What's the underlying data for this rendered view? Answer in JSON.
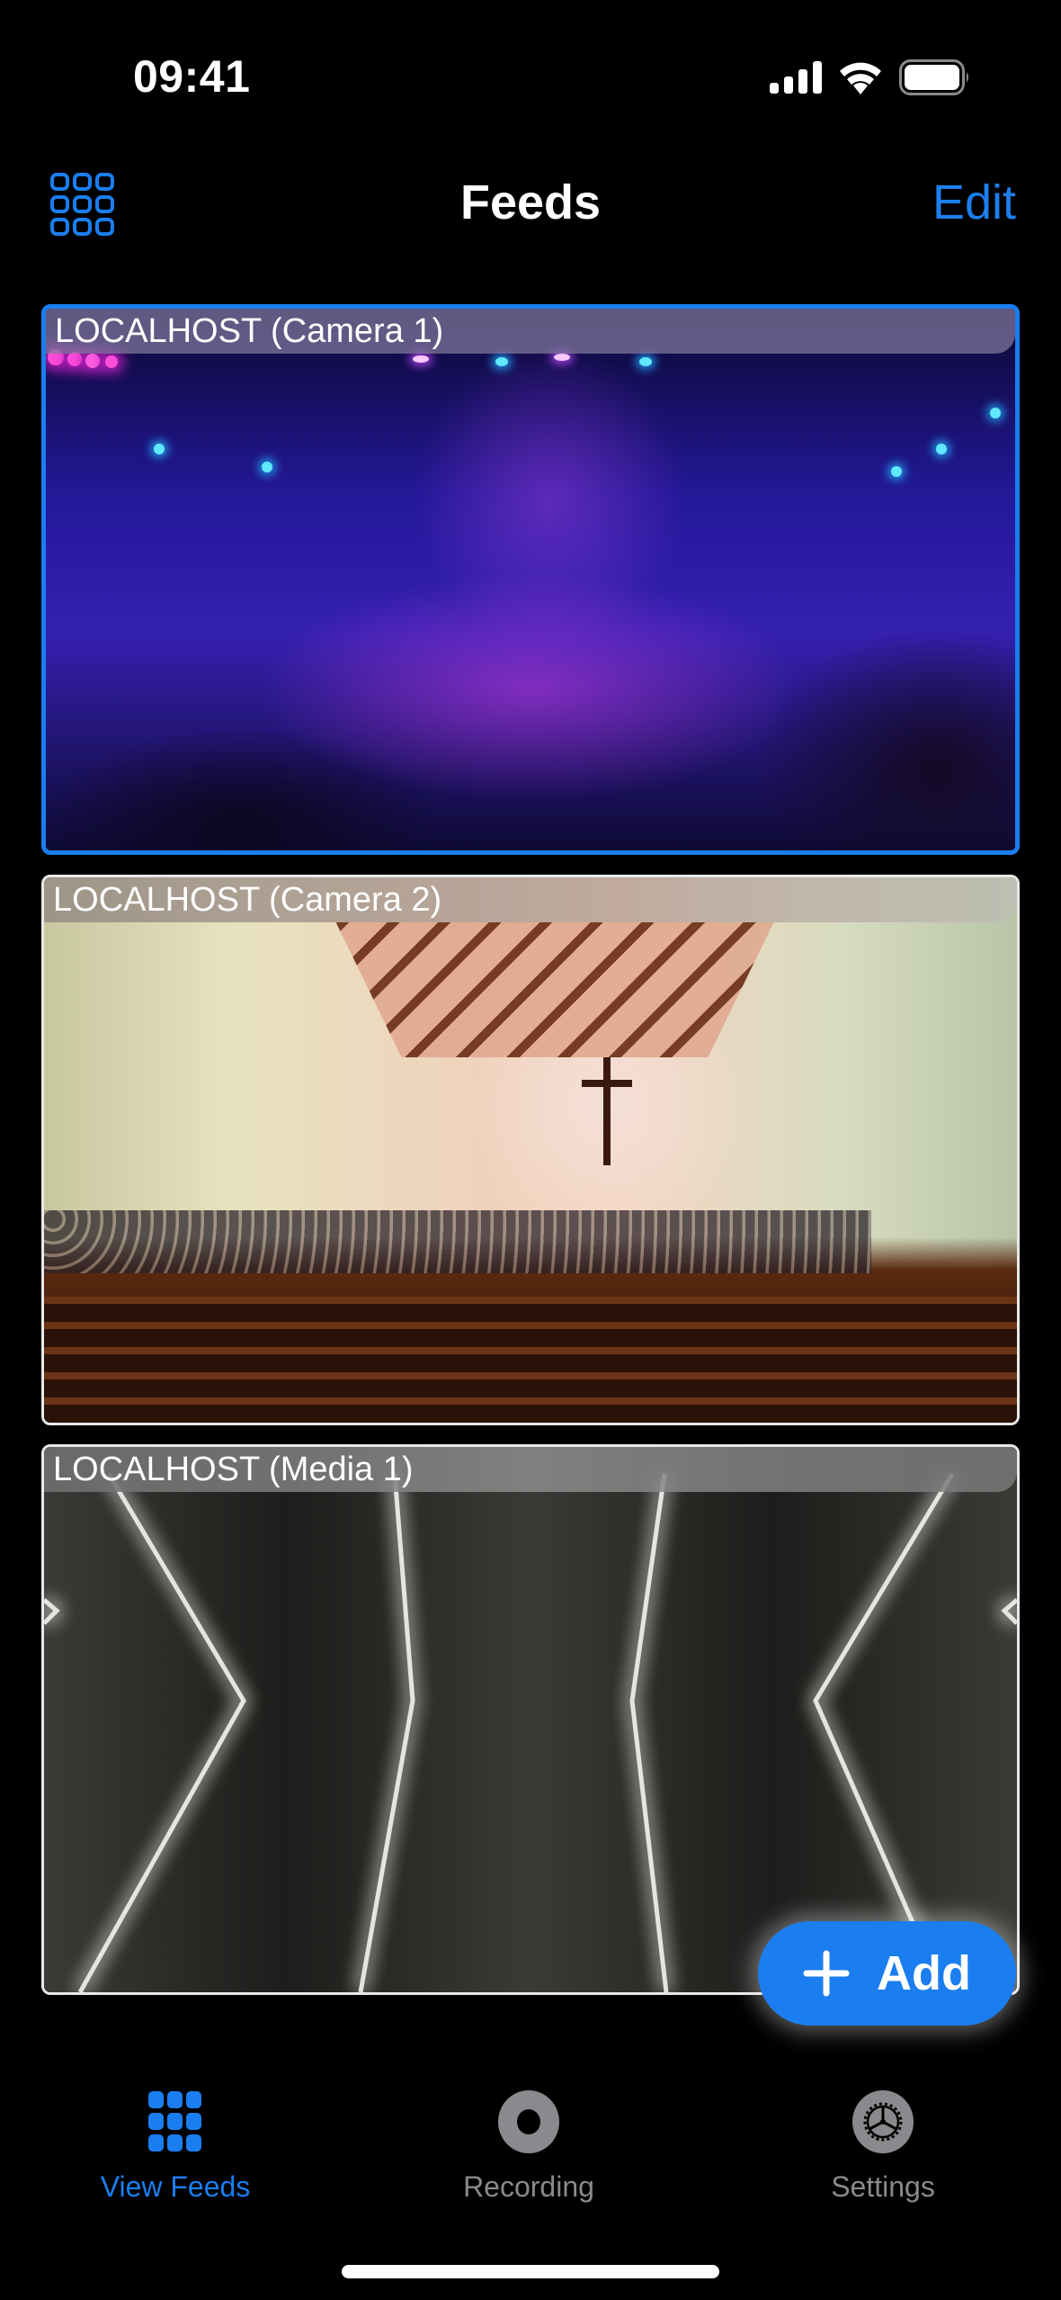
{
  "status_bar": {
    "time": "09:41",
    "icons": [
      "cellular-signal-icon",
      "wifi-icon",
      "battery-icon"
    ]
  },
  "nav": {
    "title": "Feeds",
    "left_icon": "grid-layout-icon",
    "edit_label": "Edit"
  },
  "colors": {
    "accent": "#1a7ef0",
    "inactive": "#8a8a8e",
    "background": "#000000"
  },
  "feeds": [
    {
      "label": "LOCALHOST (Camera 1)",
      "selected": true,
      "content": "concert stage with purple lighting"
    },
    {
      "label": "LOCALHOST (Camera 2)",
      "selected": false,
      "content": "church interior with congregation"
    },
    {
      "label": "LOCALHOST (Media 1)",
      "selected": false,
      "content": "glowing white chevron lines"
    }
  ],
  "add_button": {
    "icon": "plus-icon",
    "label": "Add"
  },
  "tab_bar": {
    "items": [
      {
        "label": "View Feeds",
        "icon": "grid-icon",
        "active": true
      },
      {
        "label": "Recording",
        "icon": "record-icon",
        "active": false
      },
      {
        "label": "Settings",
        "icon": "gear-icon",
        "active": false
      }
    ]
  }
}
